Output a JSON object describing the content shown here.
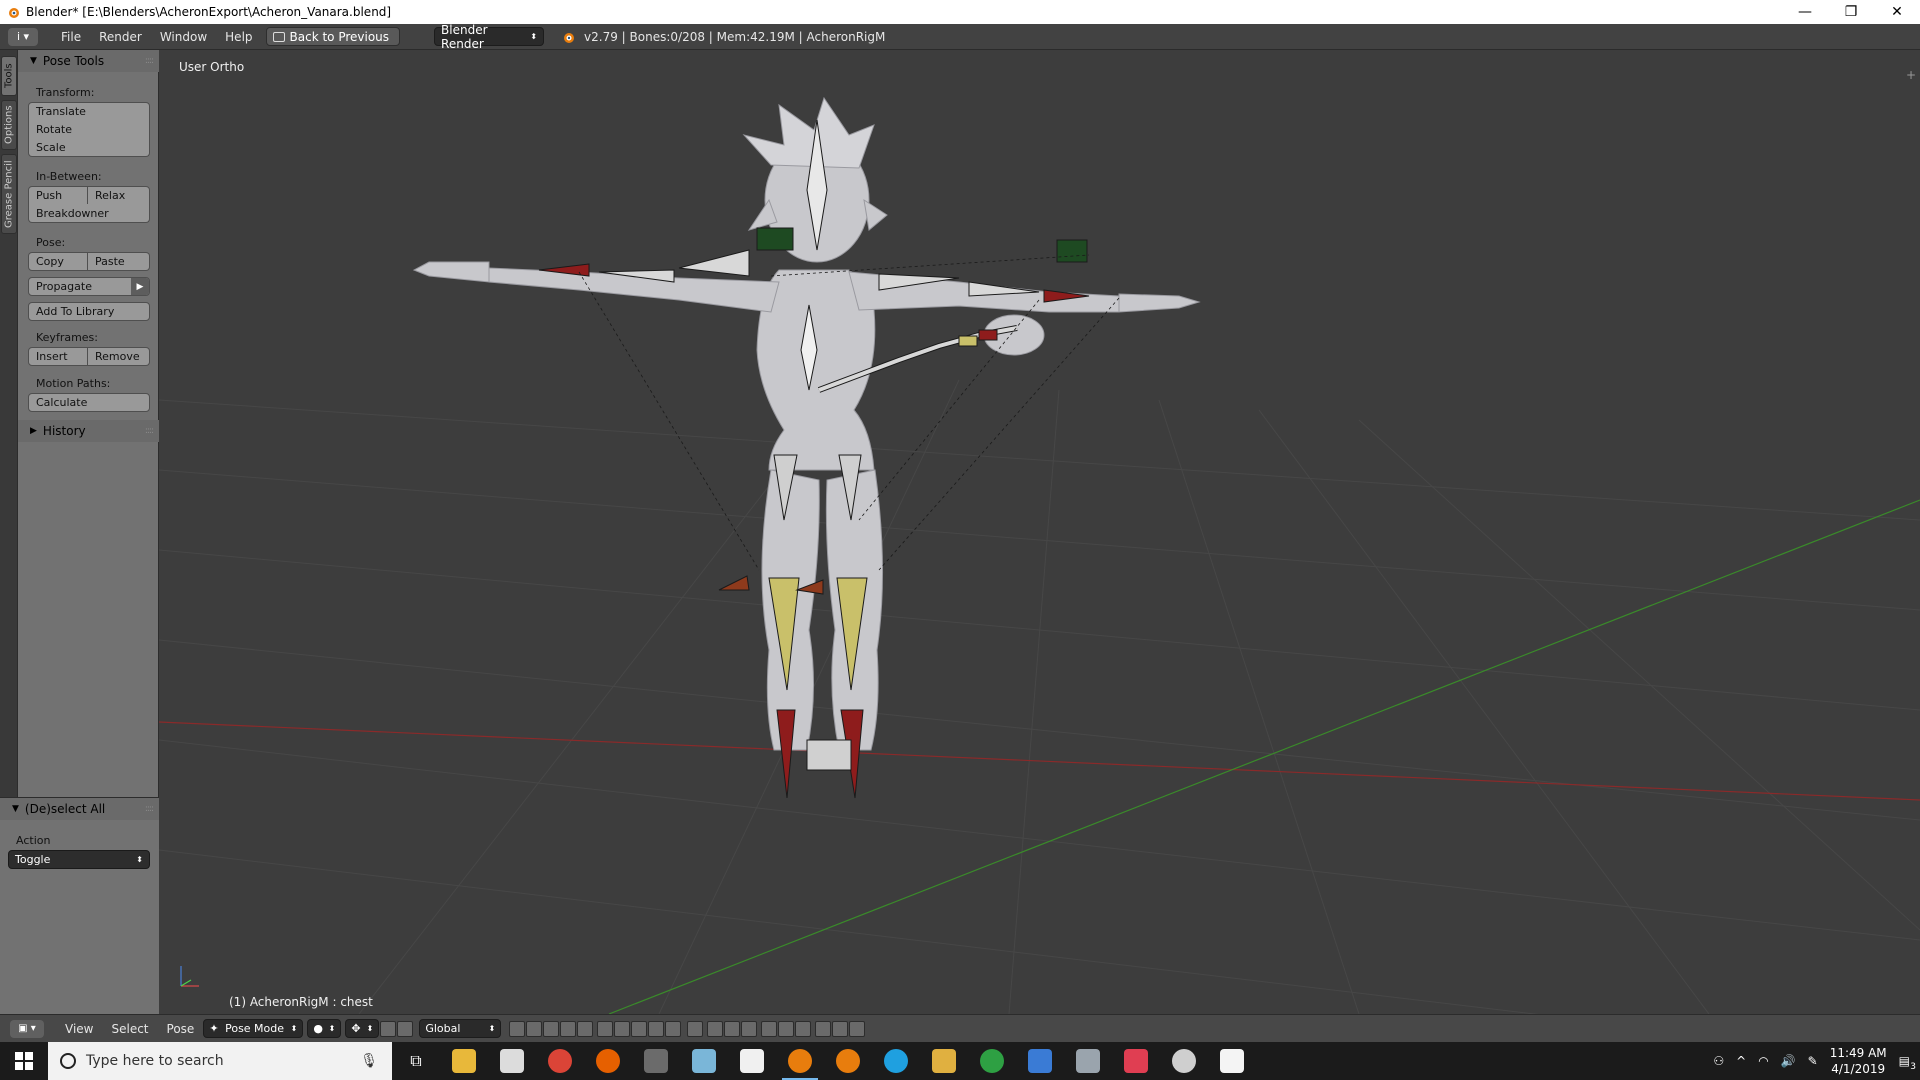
{
  "titlebar": {
    "title": "Blender* [E:\\Blenders\\AcheronExport\\Acheron_Vanara.blend]",
    "minimize": "—",
    "restore": "❐",
    "close": "✕"
  },
  "infobar": {
    "editor_icon": "i",
    "menus": [
      "File",
      "Render",
      "Window",
      "Help"
    ],
    "back_button": "Back to Previous",
    "render_engine": "Blender Render",
    "stats": "v2.79 | Bones:0/208  | Mem:42.19M | AcheronRigM"
  },
  "left_tabs": [
    "Tools",
    "Options",
    "Grease Pencil"
  ],
  "toolshelf": {
    "header": "Pose Tools",
    "transform_label": "Transform:",
    "translate": "Translate",
    "rotate": "Rotate",
    "scale": "Scale",
    "inbetween_label": "In-Between:",
    "push": "Push",
    "relax": "Relax",
    "breakdowner": "Breakdowner",
    "pose_label": "Pose:",
    "copy": "Copy",
    "paste": "Paste",
    "propagate": "Propagate",
    "add_to_library": "Add To Library",
    "keyframes_label": "Keyframes:",
    "insert": "Insert",
    "remove": "Remove",
    "motion_paths_label": "Motion Paths:",
    "calculate": "Calculate",
    "history": "History"
  },
  "operator_panel": {
    "header": "(De)select All",
    "action_label": "Action",
    "action_value": "Toggle"
  },
  "viewport": {
    "view_label": "User Ortho",
    "status": "(1) AcheronRigM : chest"
  },
  "view3d_header": {
    "menus": [
      "View",
      "Select",
      "Pose"
    ],
    "mode": "Pose Mode",
    "orientation": "Global"
  },
  "taskbar": {
    "search_placeholder": "Type here to search",
    "time": "11:49 AM",
    "date": "4/1/2019",
    "notification_count": "3"
  },
  "colors": {
    "bone_yellow": "#c9c06a",
    "bone_red": "#8e1c1c",
    "bone_green": "#1e4a22",
    "mesh": "#c8c8cc",
    "grid_red": "#8a2a2a",
    "grid_green": "#3a8a2a"
  }
}
